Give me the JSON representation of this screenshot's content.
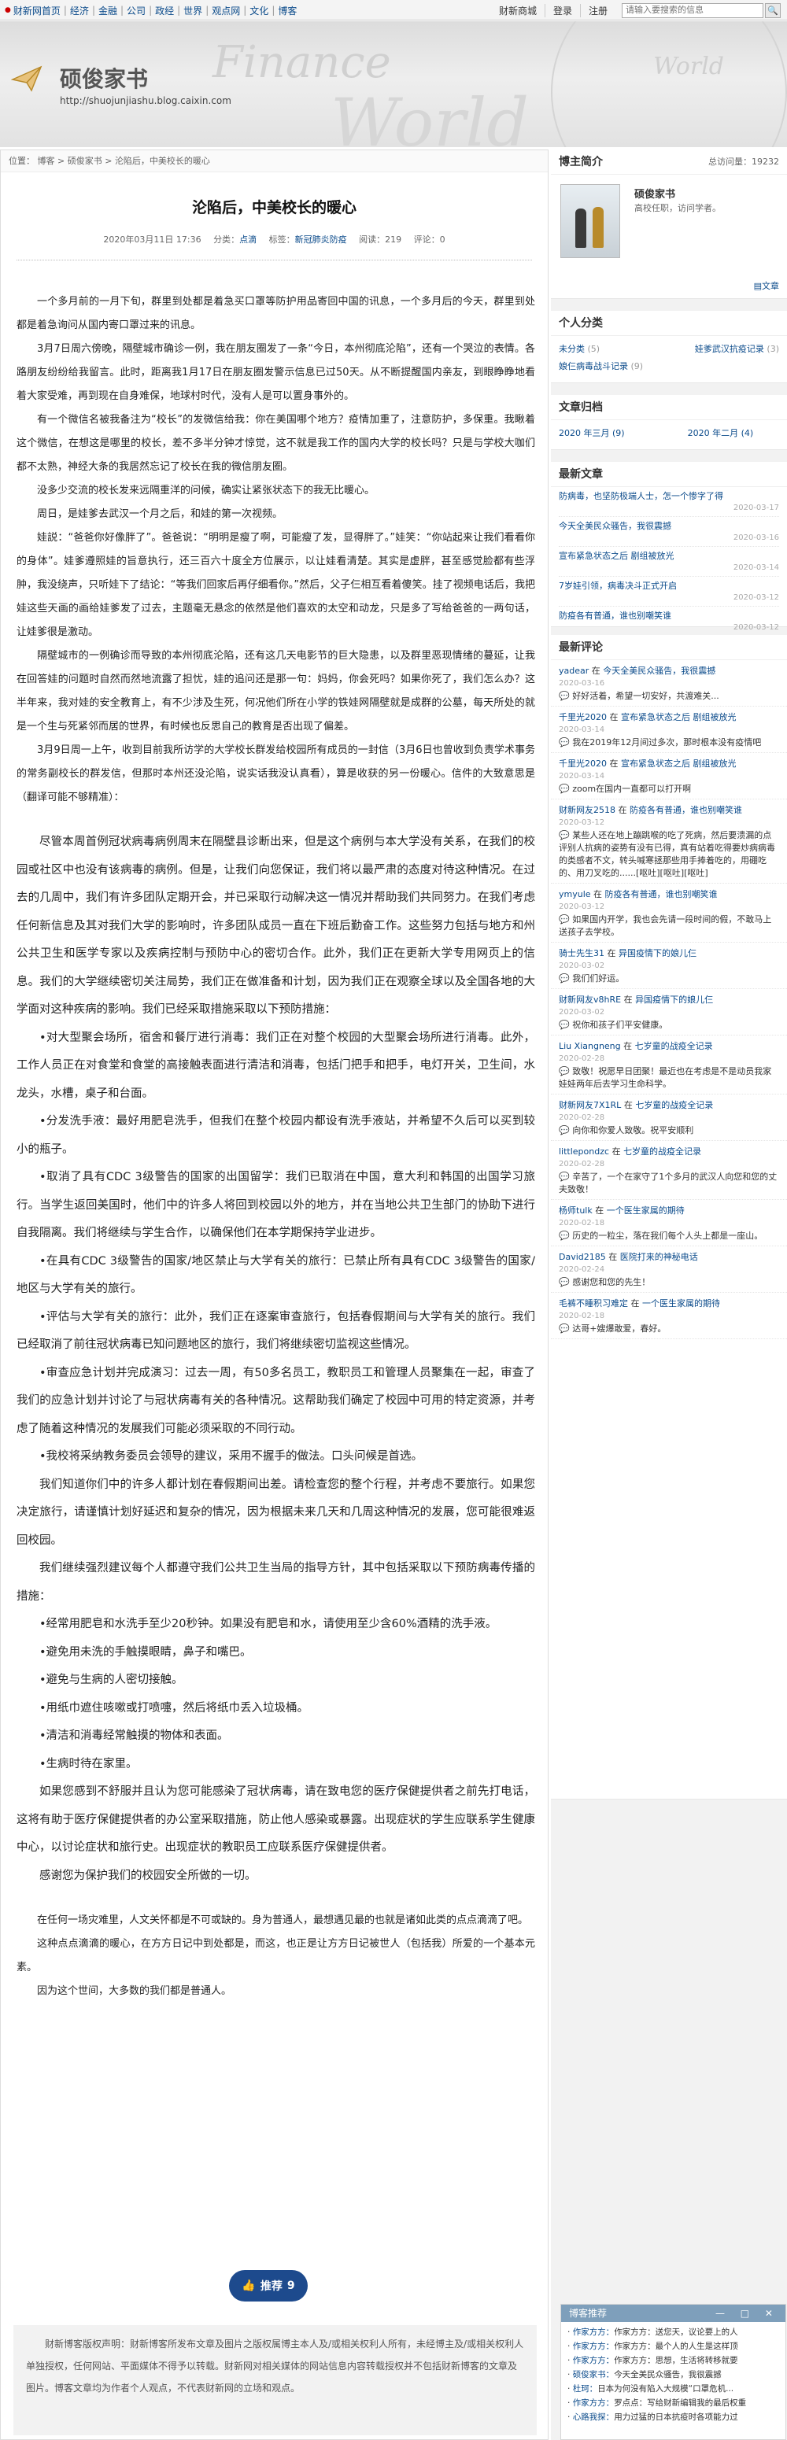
{
  "topnav": {
    "items": [
      "财新网首页",
      "经济",
      "金融",
      "公司",
      "政经",
      "世界",
      "观点网",
      "文化",
      "博客"
    ],
    "right": [
      "财新商城",
      "登录",
      "注册"
    ],
    "search_placeholder": "请输入要搜索的信息"
  },
  "banner": {
    "title": "硕俊家书",
    "url": "http://shuojunjiashu.blog.caixin.com",
    "watermark1": "Finance",
    "watermark2": "World",
    "watermark3": "World"
  },
  "breadcrumb": {
    "prefix": "位置：",
    "items": [
      "博客",
      "硕俊家书",
      "沦陷后，中美校长的暖心"
    ],
    "sep": " > "
  },
  "article": {
    "title": "沦陷后，中美校长的暖心",
    "date": "2020年03月11日 17:36",
    "cat_label": "分类：",
    "cat": "点滴",
    "tag_label": "标签：",
    "tag": "新冠肺炎防疫",
    "read_label": "阅读：",
    "read": "219",
    "rec_label": "评论：",
    "comments": "0",
    "paras": [
      "一个多月前的一月下旬，群里到处都是着急买口罩等防护用品寄回中国的讯息，一个多月后的今天，群里到处都是着急询问从国内寄口罩过来的讯息。",
      "3月7日周六傍晚，隔壁城市确诊一例，我在朋友圈发了一条“今日，本州彻底沦陷”，还有一个哭泣的表情。各路朋友纷纷给我留言。此时，距离我1月17日在朋友圈发警示信息已过50天。从不断提醒国内亲友，到眼睁睁地看着大家受难，再到现在自身难保，地球村时代，没有人是可以置身事外的。",
      "有一个微信名被我备注为“校长”的发微信给我：你在美国哪个地方？疫情加重了，注意防护，多保重。我瞅着这个微信，在想这是哪里的校长，差不多半分钟才惊觉，这不就是我工作的国内大学的校长吗？只是与学校大咖们都不太熟，神经大条的我居然忘记了校长在我的微信朋友圈。",
      "没多少交流的校长发来远隔重洋的问候，确实让紧张状态下的我无比暖心。",
      "周日，是娃爹去武汉一个月之后，和娃的第一次视频。",
      "娃説：“爸爸你好像胖了”。爸爸说：“明明是瘦了啊，可能瘦了发，显得胖了。”娃笑：“你站起来让我们看看你的身体”。娃爹遵照娃的旨意执行，还三百六十度全方位展示，以让娃看清楚。其实是虚胖，甚至感觉脸都有些浮肿，我没绕声，只听娃下了结论：“等我们回家后再仔细看你。”然后，父子仨相互看着傻笑。挂了视频电话后，我把娃这些天画的画给娃爹发了过去，主题毫无悬念的依然是他们喜欢的太空和动龙，只是多了写给爸爸的一两句话，让娃爹很是激动。",
      "隔壁城市的一例确诊而导致的本州彻底沦陷，还有这几天电影节的巨大隐患，以及群里恶现情绪的蔓延，让我在回答娃的问题时自然而然地流露了担忧，娃的追问还是那一句：妈妈，你会死吗？如果你死了，我们怎么办？这半年来，我对娃的安全教育上，有不少涉及生死，何况他们所在小学的铁娃网隔壁就是成群的公墓，每天所处的就是一个生与死紧邻而居的世界，有时候也反思自己的教育是否出现了偏差。",
      "3月9日周一上午，收到目前我所访学的大学校长群发给校园所有成员的一封信（3月6日也曾收到负责学术事务的常务副校长的群发信，但那时本州还没沦陷，说实话我没认真看），算是收获的另一份暖心。信件的大致意思是（翻译可能不够精准）："
    ],
    "letter": [
      "尽管本周首例冠状病毒病例周末在隔壁县诊断出来，但是这个病例与本大学没有关系，在我们的校园或社区中也没有该病毒的病例。但是，让我们向您保证，我们将以最严肃的态度对待这种情况。在过去的几周中，我们有许多团队定期开会，并已采取行动解决这一情况并帮助我们共同努力。在我们考虑任何新信息及其对我们大学的影响时，许多团队成员一直在下班后勤奋工作。这些努力包括与地方和州公共卫生和医学专家以及疾病控制与预防中心的密切合作。此外，我们正在更新大学专用网页上的信息。我们的大学继续密切关注局势，我们正在做准备和计划，因为我们正在观察全球以及全国各地的大学面对这种疾病的影响。我们已经采取措施采取以下预防措施：",
      "•对大型聚会场所，宿舍和餐厅进行消毒：我们正在对整个校园的大型聚会场所进行消毒。此外，工作人员正在对食堂和食堂的高接触表面进行清洁和消毒，包括门把手和把手，电灯开关，卫生间，水龙头，水槽，桌子和台面。",
      "•分发洗手液：最好用肥皂洗手，但我们在整个校园内都设有洗手液站，并希望不久后可以买到较小的瓶子。",
      "•取消了具有CDC 3级警告的国家的出国留学：我们已取消在中国，意大利和韩国的出国学习旅行。当学生返回美国时，他们中的许多人将回到校园以外的地方，并在当地公共卫生部门的协助下进行自我隔离。我们将继续与学生合作，以确保他们在本学期保持学业进步。",
      "•在具有CDC 3级警告的国家/地区禁止与大学有关的旅行：已禁止所有具有CDC 3级警告的国家/地区与大学有关的旅行。",
      "•评估与大学有关的旅行：此外，我们正在逐案审查旅行，包括春假期间与大学有关的旅行。我们已经取消了前往冠状病毒已知问题地区的旅行，我们将继续密切监视这些情况。",
      "•审查应急计划并完成演习：过去一周，有50多名员工，教职员工和管理人员聚集在一起，审查了我们的应急计划并讨论了与冠状病毒有关的各种情况。这帮助我们确定了校园中可用的特定资源，并考虑了随着这种情况的发展我们可能必须采取的不同行动。",
      "•我校将采纳教务委员会领导的建议，采用不握手的做法。口头问候是首选。",
      "我们知道你们中的许多人都计划在春假期间出差。请检查您的整个行程，并考虑不要旅行。如果您决定旅行，请谨慎计划好延迟和复杂的情况，因为根据未来几天和几周这种情况的发展，您可能很难返回校园。",
      "我们继续强烈建议每个人都遵守我们公共卫生当局的指导方针，其中包括采取以下预防病毒传播的措施：",
      "•经常用肥皂和水洗手至少20秒钟。如果没有肥皂和水，请使用至少含60%酒精的洗手液。",
      "•避免用未洗的手触摸眼睛，鼻子和嘴巴。",
      "•避免与生病的人密切接触。",
      "•用纸巾遮住咳嗽或打喷嚏，然后将纸巾丢入垃圾桶。",
      "•清洁和消毒经常触摸的物体和表面。",
      "•生病时待在家里。",
      "如果您感到不舒服并且认为您可能感染了冠状病毒，请在致电您的医疗保健提供者之前先打电话，这将有助于医疗保健提供者的办公室采取措施，防止他人感染或暴露。出现症状的学生应联系学生健康中心，以讨论症状和旅行史。出现症状的教职员工应联系医疗保健提供者。",
      "感谢您为保护我们的校园安全所做的一切。"
    ],
    "closing": [
      "在任何一场灾难里，人文关怀都是不可或缺的。身为普通人，最想遇见最的也就是诸如此类的点点滴滴了吧。",
      "这种点点滴滴的暖心，在方方日记中到处都是，而这，也正是让方方日记被世人（包括我）所爱的一个基本元素。",
      "因为这个世间，大多数的我们都是普通人。"
    ],
    "recommend_label": "推荐",
    "recommend_count": "9",
    "disclaimer": "财新博客版权声明：财新博客所发布文章及图片之版权属博主本人及/或相关权利人所有，未经博主及/或相关权利人单独授权，任何网站、平面媒体不得予以转载。财新网对相关媒体的网站信息内容转载授权并不包括财新博客的文章及图片。博客文章均为作者个人观点，不代表财新网的立场和观点。"
  },
  "sidebar": {
    "profile": {
      "header": "博主简介",
      "total_label": "总访问量：",
      "total": "19232",
      "name": "硕俊家书",
      "desc": "高校任职，访问学者。",
      "more": "文章"
    },
    "cats": {
      "header": "个人分类",
      "items": [
        {
          "name": "未分类",
          "count": "(5)"
        },
        {
          "name": "娃爹武汉抗疫记录",
          "count": "(3)"
        },
        {
          "name": "娘仨病毒战斗记录",
          "count": "(9)"
        }
      ]
    },
    "archive": {
      "header": "文章归档",
      "items": [
        "2020 年三月 (9)",
        "2020 年二月 (4)"
      ]
    },
    "latest": {
      "header": "最新文章",
      "items": [
        {
          "t": "防病毒，也坚防极端人士，怎一个惨字了得",
          "d": "2020-03-17"
        },
        {
          "t": "今天全美民众骚告，我很震撼",
          "d": "2020-03-16"
        },
        {
          "t": "宣布紧急状态之后 剧组被放光",
          "d": "2020-03-14"
        },
        {
          "t": "7岁娃引领，病毒决斗正式开启",
          "d": "2020-03-12"
        },
        {
          "t": "防疫各有普通，谁也别嘲笑谁",
          "d": "2020-03-12"
        }
      ]
    },
    "comments": {
      "header": "最新评论",
      "items": [
        {
          "who": "yadear",
          "on": "在",
          "art": "今天全美民众骚告，我很震撼",
          "date": "2020-03-16",
          "text": "好好活着，希望一切安好，共渡难关..."
        },
        {
          "who": "千里光2020",
          "on": "在",
          "art": "宣布紧急状态之后 剧组被放光",
          "date": "2020-03-14",
          "text": "我在2019年12月间过多次，那时根本没有疫情吧"
        },
        {
          "who": "千里光2020",
          "on": "在",
          "art": "宣布紧急状态之后 剧组被放光",
          "date": "2020-03-14",
          "text": "zoom在国内一直都可以打开啊"
        },
        {
          "who": "财新网友2518",
          "on": "在",
          "art": "防疫各有普通，谁也别嘲笑谁",
          "date": "2020-03-12",
          "text": "某些人还在地上蹦跳喉的吃了死病，然后要溃漏的点评别人抗病的姿势有没有已得，真有站着吃得要炒病病毒的类感者不文，转头喊寒拯那些用手捧着吃的，用硼吃的、用刀叉吃的......[呕吐][呕吐][呕吐]"
        },
        {
          "who": "ymyule",
          "on": "在",
          "art": "防疫各有普通，谁也别嘲笑谁",
          "date": "2020-03-12",
          "text": "如果国内开学，我也会先请一段时间的假，不敢马上送孩子去学校。"
        },
        {
          "who": "骑士先生31",
          "on": "在",
          "art": "异国疫情下的娘儿仨",
          "date": "2020-03-02",
          "text": "我们们好运。"
        },
        {
          "who": "财新网友v8hRE",
          "on": "在",
          "art": "异国疫情下的娘儿仨",
          "date": "2020-03-02",
          "text": "祝你和孩子们平安健康。"
        },
        {
          "who": "Liu Xiangneng",
          "on": "在",
          "art": "七岁童的战疫全记录",
          "date": "2020-02-28",
          "text": "致敬！祝愿早日团聚！最近也在考虑是不是动员我家娃娃两年后去学习生命科学。"
        },
        {
          "who": "财新网友7X1RL",
          "on": "在",
          "art": "七岁童的战疫全记录",
          "date": "2020-02-28",
          "text": "向你和你爱人致敬。祝平安顺利"
        },
        {
          "who": "littlepondzc",
          "on": "在",
          "art": "七岁童的战疫全记录",
          "date": "2020-02-28",
          "text": "辛苦了，一个在家守了1个多月的武汉人向您和您的丈夫致敬！"
        },
        {
          "who": "杨师tulk",
          "on": "在",
          "art": "一个医生家属的期待",
          "date": "2020-02-18",
          "text": "历史的一粒尘，落在我们每个人头上都是一座山。"
        },
        {
          "who": "David2185",
          "on": "在",
          "art": "医院打来的神秘电话",
          "date": "2020-02-24",
          "text": "感谢您和您的先生！"
        },
        {
          "who": "毛裤不睡积习难定",
          "on": "在",
          "art": "一个医生家属的期待",
          "date": "2020-02-18",
          "text": "达哥+嫂爆敢爱，春好。"
        }
      ]
    }
  },
  "widget": {
    "title": "博客推荐",
    "controls": "— □ ✕",
    "items": [
      {
        "a": "作家方方：",
        "t": "作家方方：送您天，议论要上的人"
      },
      {
        "a": "作家方方：",
        "t": "作家方方：最个人的人生是这样顶"
      },
      {
        "a": "作家方方：",
        "t": "作家方方：思想，生活将转移就要"
      },
      {
        "a": "硕俊家书：",
        "t": "今天全美民众骚告，我很震撼"
      },
      {
        "a": "杜珂：",
        "t": "日本为何没有陷入大规模“口罩危机..."
      },
      {
        "a": "作家方方：",
        "t": "罗点点：写给财新编辑我的最后权重"
      },
      {
        "a": "心路我探：",
        "t": "用力过猛的日本抗疫时各项能力过"
      }
    ]
  }
}
